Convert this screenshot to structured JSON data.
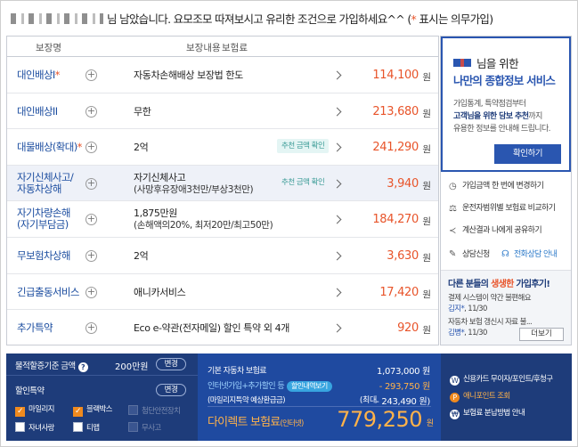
{
  "notice": {
    "lead": "님 남았습니다. 요모조모 따져보시고 유리한 조건으로 가입하세요^^ (",
    "star": "*",
    "tail": " 표시는 의무가입)"
  },
  "table": {
    "header": {
      "name": "보장명",
      "content": "보장내용",
      "amount": "보험료"
    },
    "unit": "원",
    "rows": [
      {
        "name": "대인배상I",
        "star": "*",
        "desc": "자동차손해배상 보장법 한도",
        "price": "114,100"
      },
      {
        "name": "대인배상II",
        "star": "",
        "desc": "무한",
        "price": "213,680"
      },
      {
        "name": "대물배상(확대)",
        "star": "*",
        "desc": "2억",
        "badge": "추천 금액 확인",
        "price": "241,290"
      },
      {
        "name1": "자기신체사고/",
        "name2": "자동차상해",
        "desc1": "자기신체사고",
        "desc2": "(사망후유장애3천만/부상3천만)",
        "badge": "추천 금액 확인",
        "price": "3,940"
      },
      {
        "name1": "자기차량손해",
        "name2": "(자기부담금)",
        "desc1": "1,875만원",
        "desc2": "(손해액의20%, 최저20만/최고50만)",
        "price": "184,270"
      },
      {
        "name": "무보험차상해",
        "desc": "2억",
        "price": "3,630"
      },
      {
        "name": "긴급출동서비스",
        "desc": "애니카서비스",
        "price": "17,420"
      },
      {
        "name": "추가특약",
        "desc": "Eco e-약관(전자메일) 할인 특약 외 4개",
        "price": "920"
      }
    ]
  },
  "promo": {
    "title1": "님을 위한",
    "title2": "나만의 종합정보 서비스",
    "line1": "가입통계, 특약점검부터",
    "line2_bold": "고객님을 위한 담보 추천",
    "line2_rest": "까지",
    "line3": "유용한 정보를 안내해 드립니다.",
    "button": "확인하기"
  },
  "menu": {
    "items": [
      {
        "icon": "clock-icon",
        "label": "가입금액 한 번에 변경하기"
      },
      {
        "icon": "scale-icon",
        "label": "운전자범위별 보험료 비교하기"
      },
      {
        "icon": "share-icon",
        "label": "계산결과 나에게 공유하기"
      }
    ],
    "consult": "상담신청",
    "phone_guide": "전화상담 안내"
  },
  "reviews": {
    "title_a": "다른 분들의 ",
    "title_em": "생생한",
    "title_b": " 가입후기!",
    "r1": "결제 시스템이 약간 불편해요",
    "r1_who": "김지*",
    "r1_date": ", 11/30",
    "r2": "자동차 보험 갱신시 자료 불...",
    "r2_who": "김병*",
    "r2_date": ", 11/30",
    "more": "더보기"
  },
  "bottom": {
    "mileage_label": "물적할증기준 금액",
    "mileage_value": "200만원",
    "change": "변경",
    "discount_label": "할인특약",
    "checks": [
      {
        "label": "마일리지",
        "on": true
      },
      {
        "label": "블랙박스",
        "on": true
      },
      {
        "label": "첨단안전장치",
        "dis": true
      },
      {
        "label": "자녀사랑",
        "on": false
      },
      {
        "label": "티맵",
        "on": false
      },
      {
        "label": "무사고",
        "dis": true
      }
    ],
    "base_label": "기본 자동차 보험료",
    "base_value": "1,073,000 원",
    "disc_label": "인터넷가입+추가할인 등",
    "disc_tag": "할인내역보기",
    "disc_value": "- 293,750 원",
    "mileage_refund_label": "(마일리지특약 예상환급금)",
    "mileage_refund_max": "(최대",
    "mileage_refund_value": "- 243,490 원)",
    "final_label": "다이렉트 보험료",
    "final_small": "(인터넷)",
    "final_value": "779,250",
    "final_unit": "원",
    "side": [
      {
        "label": "신용카드 무이자/포인트/후청구",
        "dot": "W"
      },
      {
        "label": "애니포인트 조회",
        "dot": "P"
      },
      {
        "label": "보험료 분납방법 안내",
        "dot": "₩"
      }
    ]
  }
}
